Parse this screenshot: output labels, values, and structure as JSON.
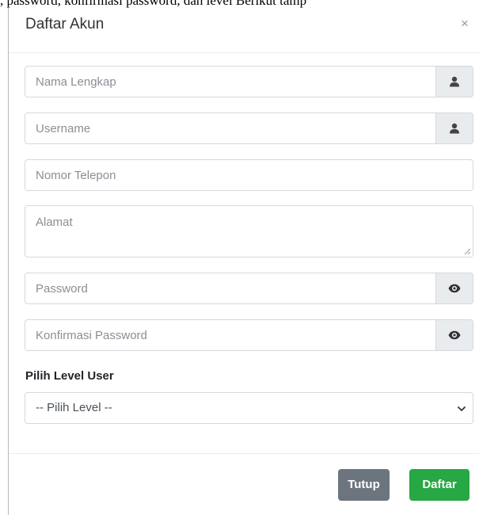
{
  "background_text": ", password, konfirmasi password, dan level Berikut tamp",
  "modal": {
    "title": "Daftar Akun",
    "close_label": "×"
  },
  "form": {
    "nama_lengkap_placeholder": "Nama Lengkap",
    "username_placeholder": "Username",
    "nomor_telepon_placeholder": "Nomor Telepon",
    "alamat_placeholder": "Alamat",
    "password_placeholder": "Password",
    "konfirmasi_password_placeholder": "Konfirmasi Password",
    "level_label": "Pilih Level User",
    "level_selected": "-- Pilih Level --"
  },
  "icons": {
    "nama_lengkap": "user-icon",
    "username": "user-icon",
    "password": "eye-icon",
    "konfirmasi_password": "eye-icon",
    "select": "chevron-down-icon"
  },
  "buttons": {
    "tutup_label": "Tutup",
    "daftar_label": "Daftar"
  },
  "colors": {
    "tutup": "#6c757d",
    "daftar": "#28a745",
    "addon": "#e9ecef"
  }
}
